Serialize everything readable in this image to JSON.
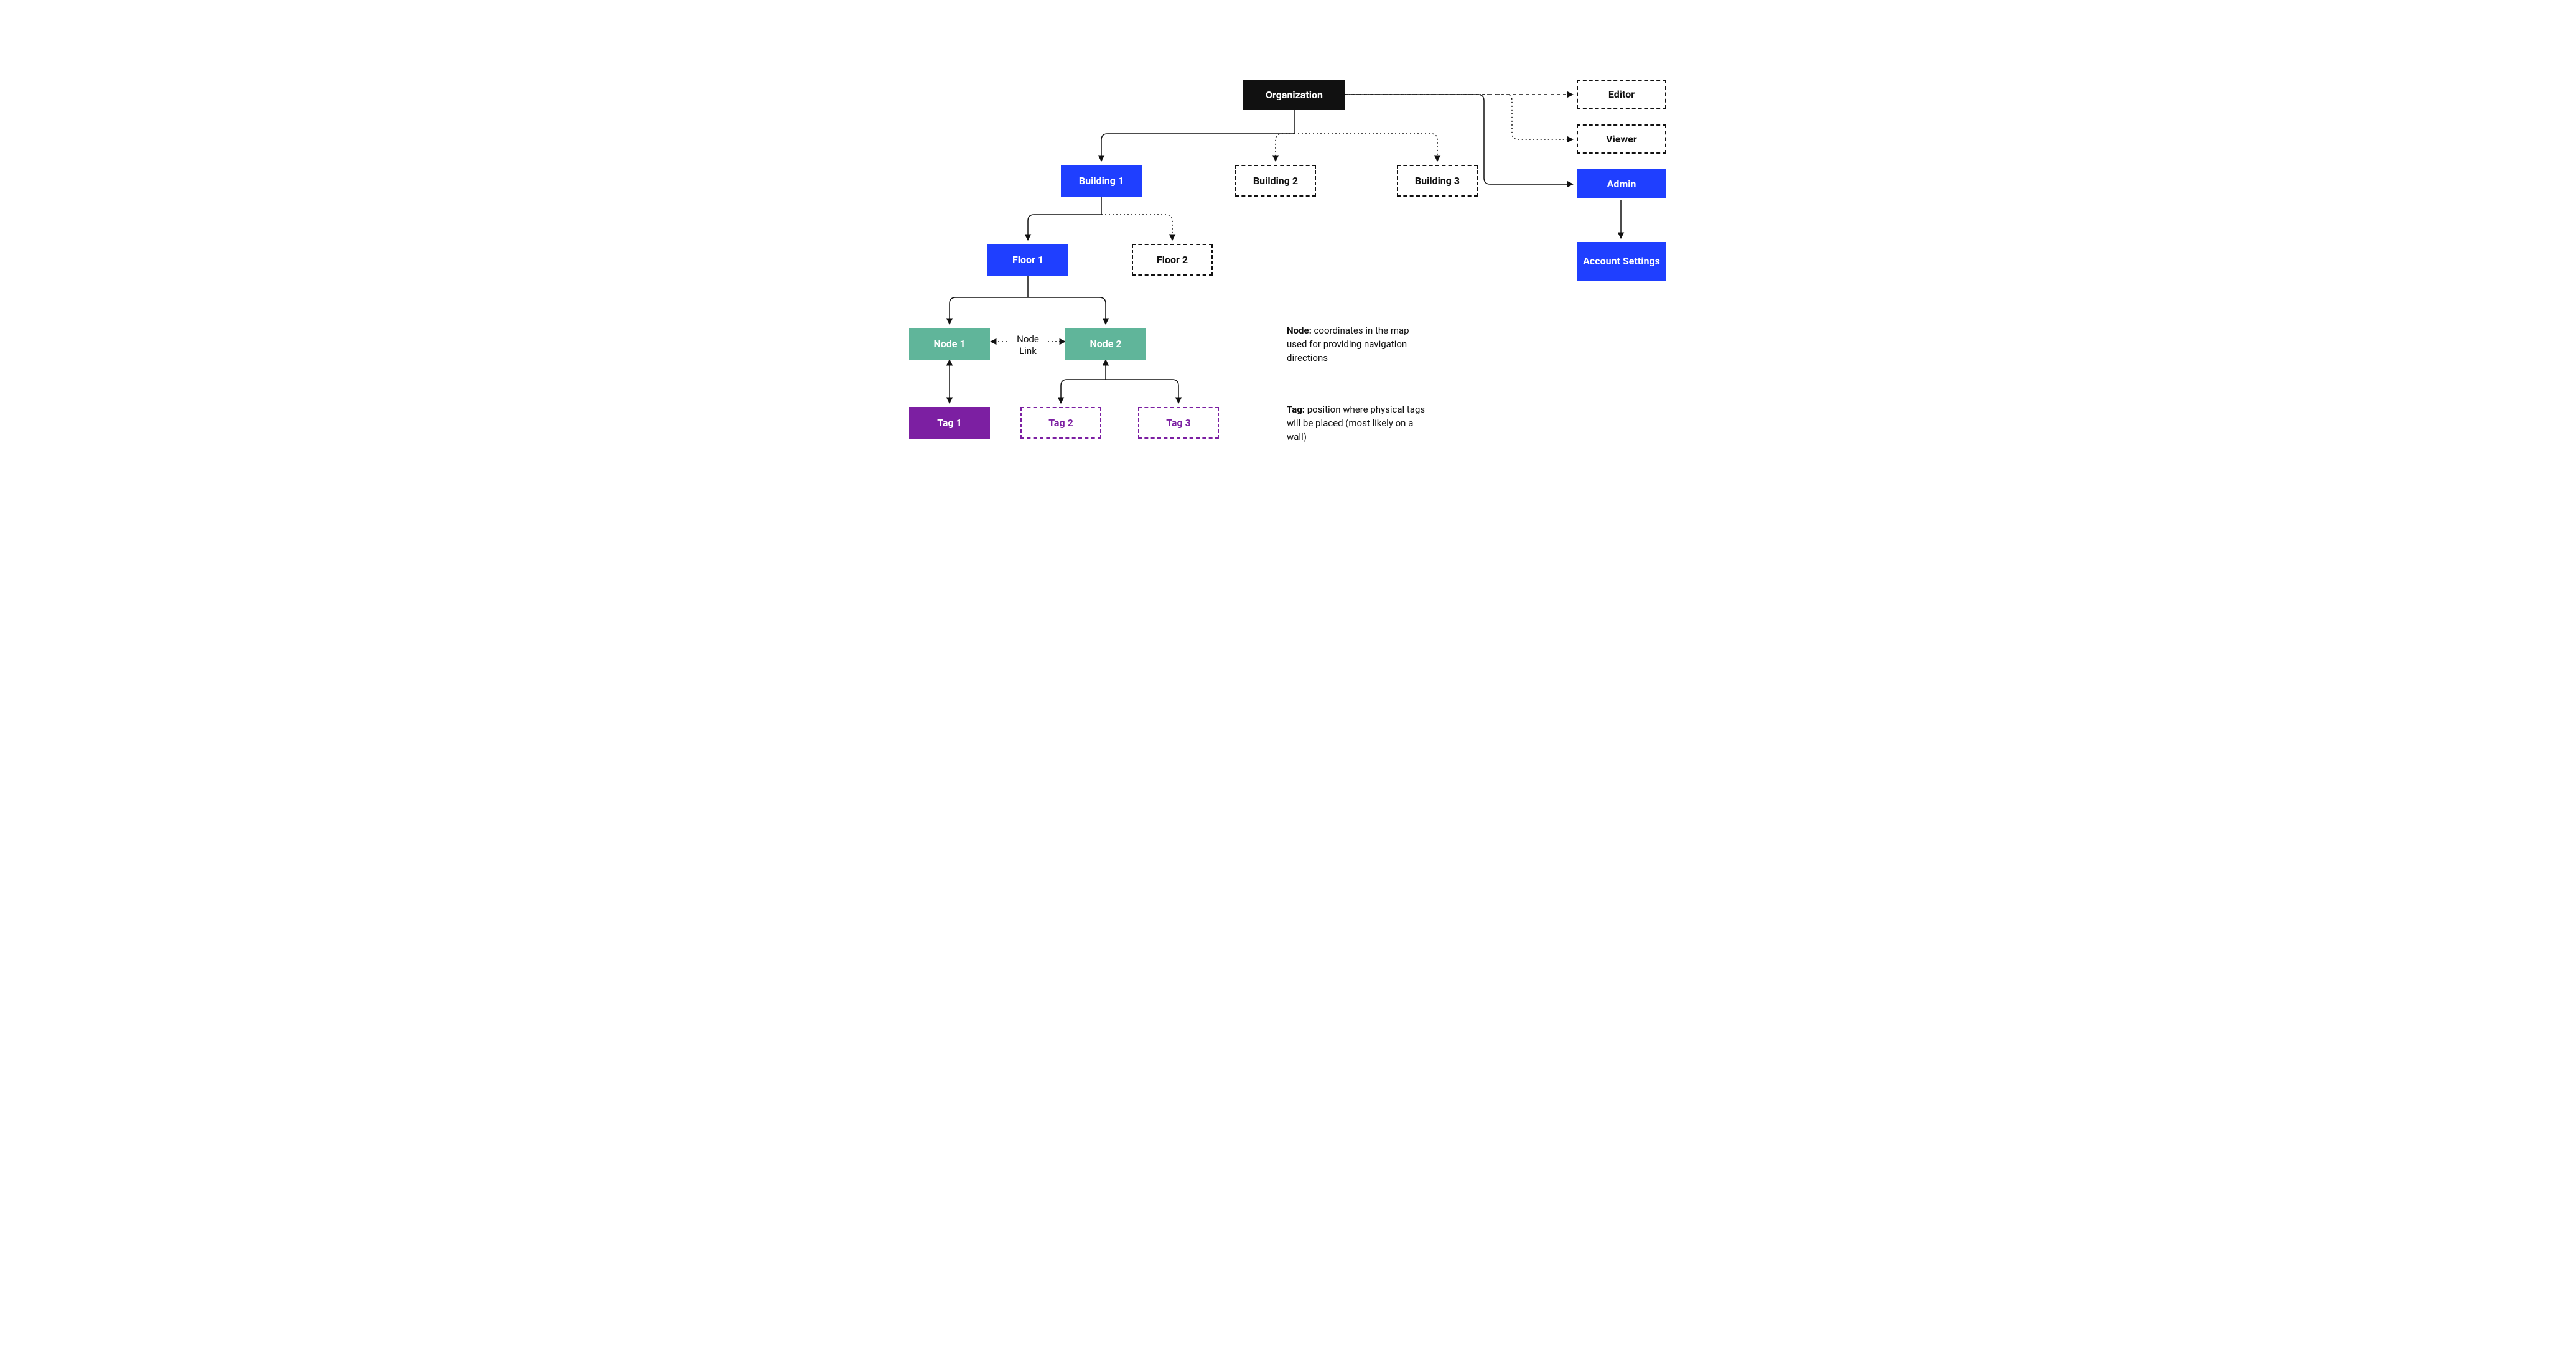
{
  "nodes": {
    "organization": "Organization",
    "building1": "Building 1",
    "building2": "Building 2",
    "building3": "Building 3",
    "floor1": "Floor 1",
    "floor2": "Floor 2",
    "node1": "Node 1",
    "node2": "Node 2",
    "tag1": "Tag 1",
    "tag2": "Tag 2",
    "tag3": "Tag 3",
    "editor": "Editor",
    "viewer": "Viewer",
    "admin": "Admin",
    "accountSettings": "Account Settings"
  },
  "labels": {
    "nodeLink": "Node Link"
  },
  "defs": {
    "node_label": "Node:",
    "node_text": " coordinates in the map used for providing navigation directions",
    "tag_label": "Tag:",
    "tag_text": " position where physical tags will be placed (most likely on a wall)"
  },
  "colors": {
    "black": "#111111",
    "blue": "#1f3fff",
    "teal": "#60b59a",
    "purple": "#7c1fa2",
    "white": "#ffffff"
  }
}
